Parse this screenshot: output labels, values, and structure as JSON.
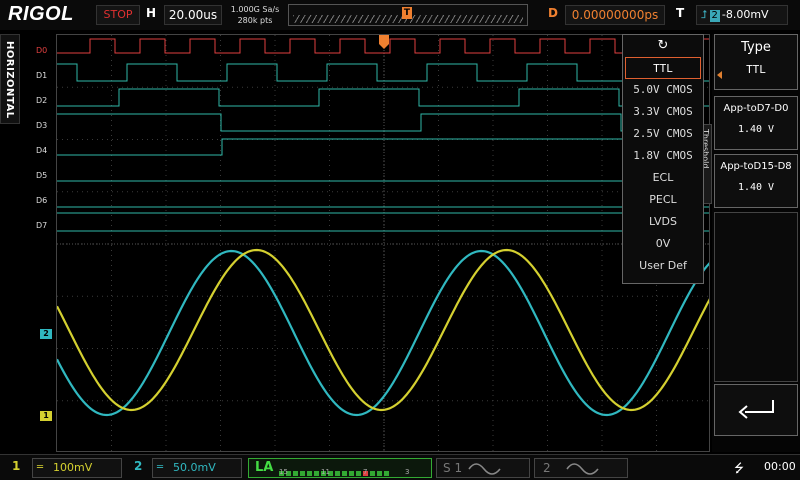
{
  "brand": "RIGOL",
  "topbar": {
    "run_state": "STOP",
    "horizontal_label": "H",
    "timebase": "20.00us",
    "sample_rate": "1.000G Sa/s",
    "memory_depth": "280k pts",
    "trigger_marker": "T",
    "delay_label": "D",
    "delay": "0.00000000ps",
    "trigger_label": "T",
    "trigger_source": "2",
    "trigger_level": "-8.00mV"
  },
  "left_tab": {
    "label": "HORIZONTAL"
  },
  "digital_channels": [
    "D0",
    "D1",
    "D2",
    "D3",
    "D4",
    "D5",
    "D6",
    "D7"
  ],
  "analog_markers": {
    "ch1": "1",
    "ch2": "2"
  },
  "threshold_popup": {
    "options": [
      "TTL",
      "5.0V CMOS",
      "3.3V CMOS",
      "2.5V CMOS",
      "1.8V CMOS",
      "ECL",
      "PECL",
      "LVDS",
      "0V",
      "User Def"
    ],
    "selected": "TTL"
  },
  "threshold_side_tab": "Threshold",
  "right_menu": {
    "type_title": "Type",
    "type_value": "TTL",
    "btn1_label": "App-toD7-D0",
    "btn1_value": "1.40 V",
    "btn2_label": "App-toD15-D8",
    "btn2_value": "1.40 V"
  },
  "bottom": {
    "ch1_num": "1",
    "ch1_scale": "100mV",
    "ch2_num": "2",
    "ch2_scale": "50.0mV",
    "la_label": "LA",
    "la_numbers": [
      "15",
      "11",
      "7",
      "3"
    ],
    "s1_label": "S",
    "s1_num": "1",
    "s2_num": "2",
    "time": "00:00"
  },
  "colors": {
    "ch1": "#d4d030",
    "ch2": "#30b8c0",
    "d0": "#e04040",
    "digital": "#30b8a8",
    "accent": "#f08030"
  }
}
